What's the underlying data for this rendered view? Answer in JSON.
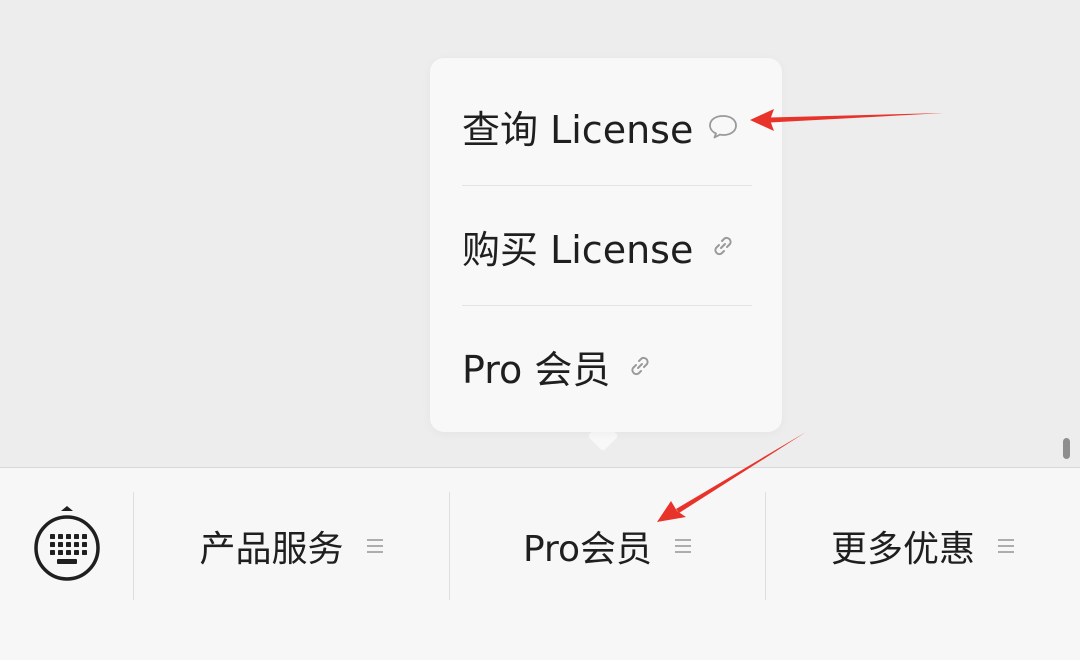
{
  "popup": {
    "items": [
      {
        "label": "查询 License",
        "icon": "chat-bubble-icon"
      },
      {
        "label": "购买 License",
        "icon": "link-icon"
      },
      {
        "label": "Pro 会员",
        "icon": "link-icon"
      }
    ]
  },
  "menu_bar": {
    "keyboard_icon": "keyboard-icon",
    "items": [
      {
        "label": "产品服务",
        "icon": "menu-lines-icon"
      },
      {
        "label": "Pro会员",
        "icon": "menu-lines-icon"
      },
      {
        "label": "更多优惠",
        "icon": "menu-lines-icon"
      }
    ]
  },
  "colors": {
    "background": "#ededed",
    "popup_bg": "#f8f8f8",
    "menu_bar_bg": "#f7f7f7",
    "text": "#1f1f1f",
    "icon_gray": "#9a9a9a",
    "annotation_red": "#e8332a"
  }
}
